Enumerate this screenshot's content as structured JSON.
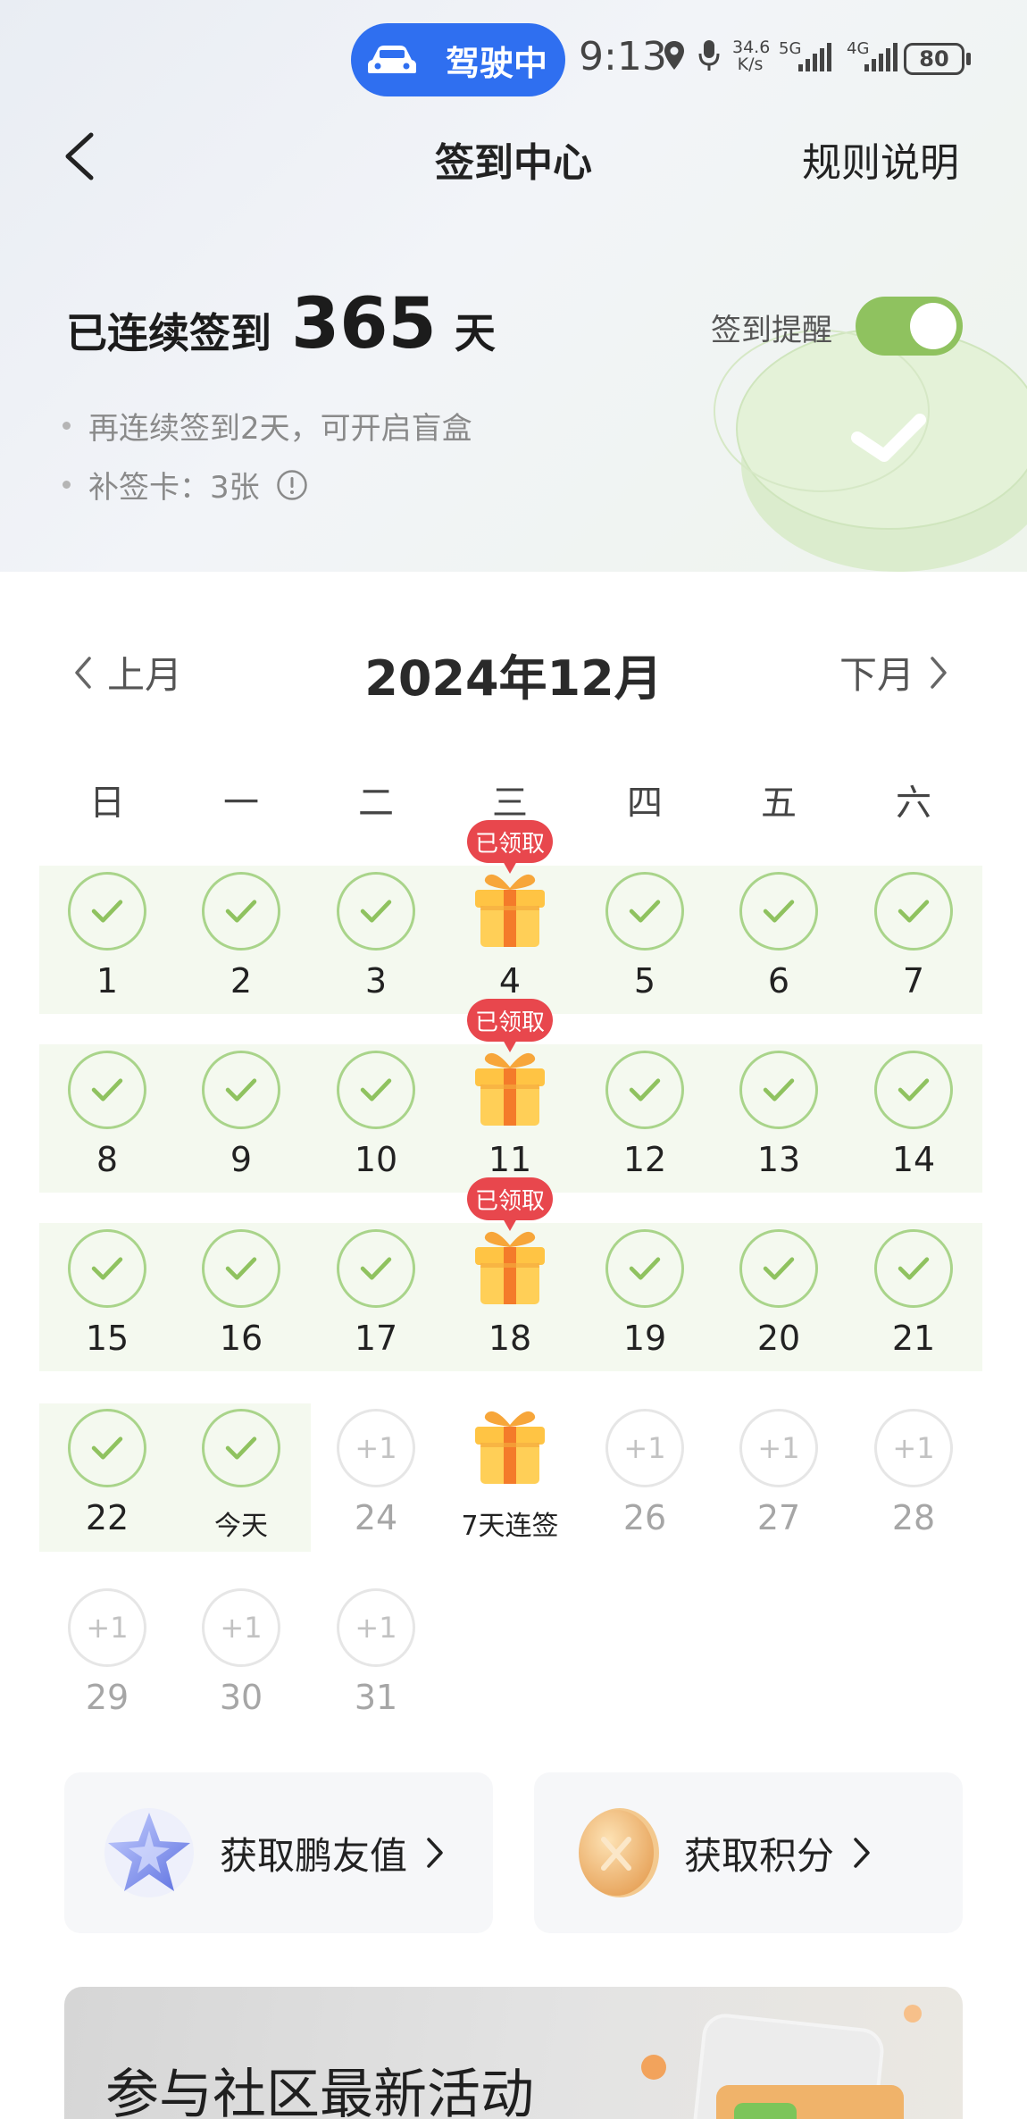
{
  "status_bar": {
    "driving_label": "驾驶中",
    "time": "9:13",
    "net_speed_value": "34.6",
    "net_speed_unit": "K/s",
    "net_type_1": "5G",
    "net_type_2": "4G",
    "battery": "80"
  },
  "nav": {
    "title": "签到中心",
    "rules_label": "规则说明"
  },
  "streak": {
    "prefix": "已连续签到",
    "days": "365",
    "suffix": "天",
    "reminder_label": "签到提醒",
    "reminder_on": true,
    "tips": [
      "再连续签到2天，可开启盲盒",
      "补签卡：3张"
    ]
  },
  "calendar": {
    "prev_label": "上月",
    "next_label": "下月",
    "month_title": "2024年12月",
    "weekdays": [
      "日",
      "一",
      "二",
      "三",
      "四",
      "五",
      "六"
    ],
    "claimed_badge": "已领取",
    "future_reward": "+1",
    "today_label": "今天",
    "streak_gift_label": "7天连签",
    "rows": [
      [
        "1",
        "2",
        "3",
        "4",
        "5",
        "6",
        "7"
      ],
      [
        "8",
        "9",
        "10",
        "11",
        "12",
        "13",
        "14"
      ],
      [
        "15",
        "16",
        "17",
        "18",
        "19",
        "20",
        "21"
      ],
      [
        "22",
        "今天",
        "24",
        "7天连签",
        "26",
        "27",
        "28"
      ],
      [
        "29",
        "30",
        "31"
      ]
    ]
  },
  "rewards": {
    "friend_value_label": "获取鹏友值",
    "points_label": "获取积分"
  },
  "banner": {
    "title": "参与社区最新活动"
  },
  "colors": {
    "accent_green": "#8fc25f",
    "badge_red": "#e8474d",
    "driving_blue": "#2f6ff0"
  }
}
